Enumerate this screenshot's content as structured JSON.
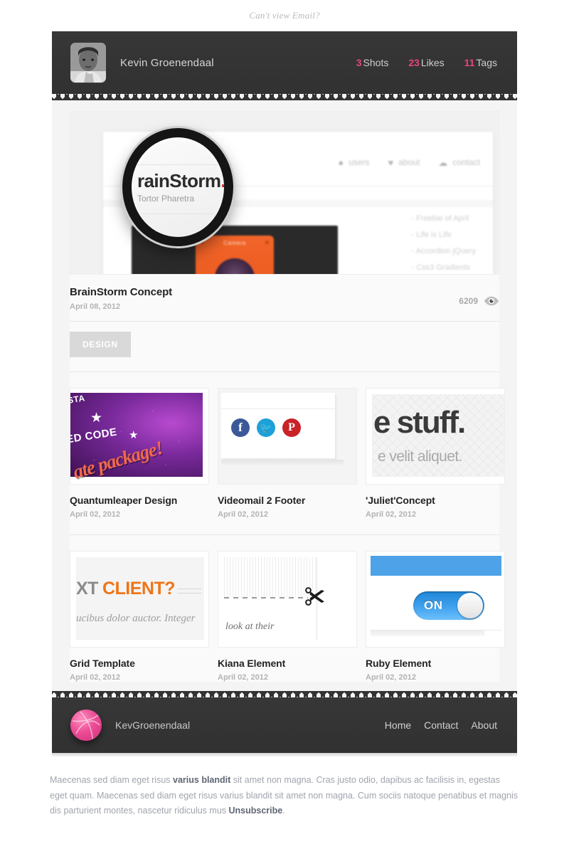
{
  "preheader": {
    "text": "Can't view Email?"
  },
  "header": {
    "avatar_name": "user-photo",
    "name": "Kevin Groenendaal",
    "stats": [
      {
        "num": "3",
        "label": "Shots"
      },
      {
        "num": "23",
        "label": "Likes"
      },
      {
        "num": "11",
        "label": "Tags"
      }
    ]
  },
  "featured": {
    "title": "BrainStorm Concept",
    "date": "April 08, 2012",
    "views": "6209",
    "tag": "DESIGN",
    "preview": {
      "magnifier_title": "rainStorm",
      "magnifier_dot": ".",
      "magnifier_subtitle": "Tortor Pharetra",
      "nav": [
        {
          "icon": "speech-bubble-icon",
          "glyph": "●",
          "label": "users"
        },
        {
          "icon": "heart-icon",
          "glyph": "♥",
          "label": "about"
        },
        {
          "icon": "cloud-icon",
          "glyph": "☁",
          "label": "contact"
        }
      ],
      "list": [
        "- Freebie of April",
        "- Life is Life",
        "- Accordion jQuery",
        "- Css3 Gradients"
      ],
      "camera_label": "Camera"
    }
  },
  "thumbnails": [
    {
      "title": "Quantumleaper Design",
      "date": "April 02, 2012",
      "art": "quantumleaper",
      "text": {
        "code1": "STA",
        "code2": "ED CODE",
        "package": "ate package!"
      }
    },
    {
      "title": "Videomail 2 Footer",
      "date": "April 02, 2012",
      "art": "videomail",
      "socials": [
        {
          "name": "facebook-icon",
          "glyph": "f",
          "color": "#3B5998"
        },
        {
          "name": "twitter-icon",
          "glyph": "ᵗ",
          "color": "#1DA1D8"
        },
        {
          "name": "pinterest-icon",
          "glyph": "ᴘ",
          "color": "#C92228"
        }
      ]
    },
    {
      "title": "'Juliet'Concept",
      "date": "April 02, 2012",
      "art": "juliet",
      "text": {
        "big": "e stuff.",
        "small": "e velit aliquet."
      }
    },
    {
      "title": "Grid Template",
      "date": "April 02, 2012",
      "art": "grid",
      "text": {
        "prefix": "XT",
        "accent": "CLIENT?",
        "serif": "ucibus dolor auctor. Integer"
      }
    },
    {
      "title": "Kiana Element",
      "date": "April 02, 2012",
      "art": "kiana",
      "text": {
        "caption": "look at their"
      }
    },
    {
      "title": "Ruby Element",
      "date": "April 02, 2012",
      "art": "ruby",
      "text": {
        "toggle": "ON"
      }
    }
  ],
  "footer": {
    "logo": "dribbble-icon",
    "name": "KevGroenendaal",
    "nav": [
      "Home",
      "Contact",
      "About"
    ]
  },
  "legal": {
    "p1": "Maecenas sed diam eget risus ",
    "b1": "varius blandit",
    "p2": " sit amet non magna. Cras justo odio, dapibus ac facilisis in, egestas eget quam. Maecenas sed diam eget risus varius blandit sit amet non magna. Cum sociis natoque penatibus et magnis dis parturient montes, nascetur ridiculus mus ",
    "b2": "Unsubscribe",
    "p3": "."
  },
  "colors": {
    "accent_pink": "#e6447f",
    "dark_bar": "#333333",
    "panel": "#f4f4f4"
  }
}
